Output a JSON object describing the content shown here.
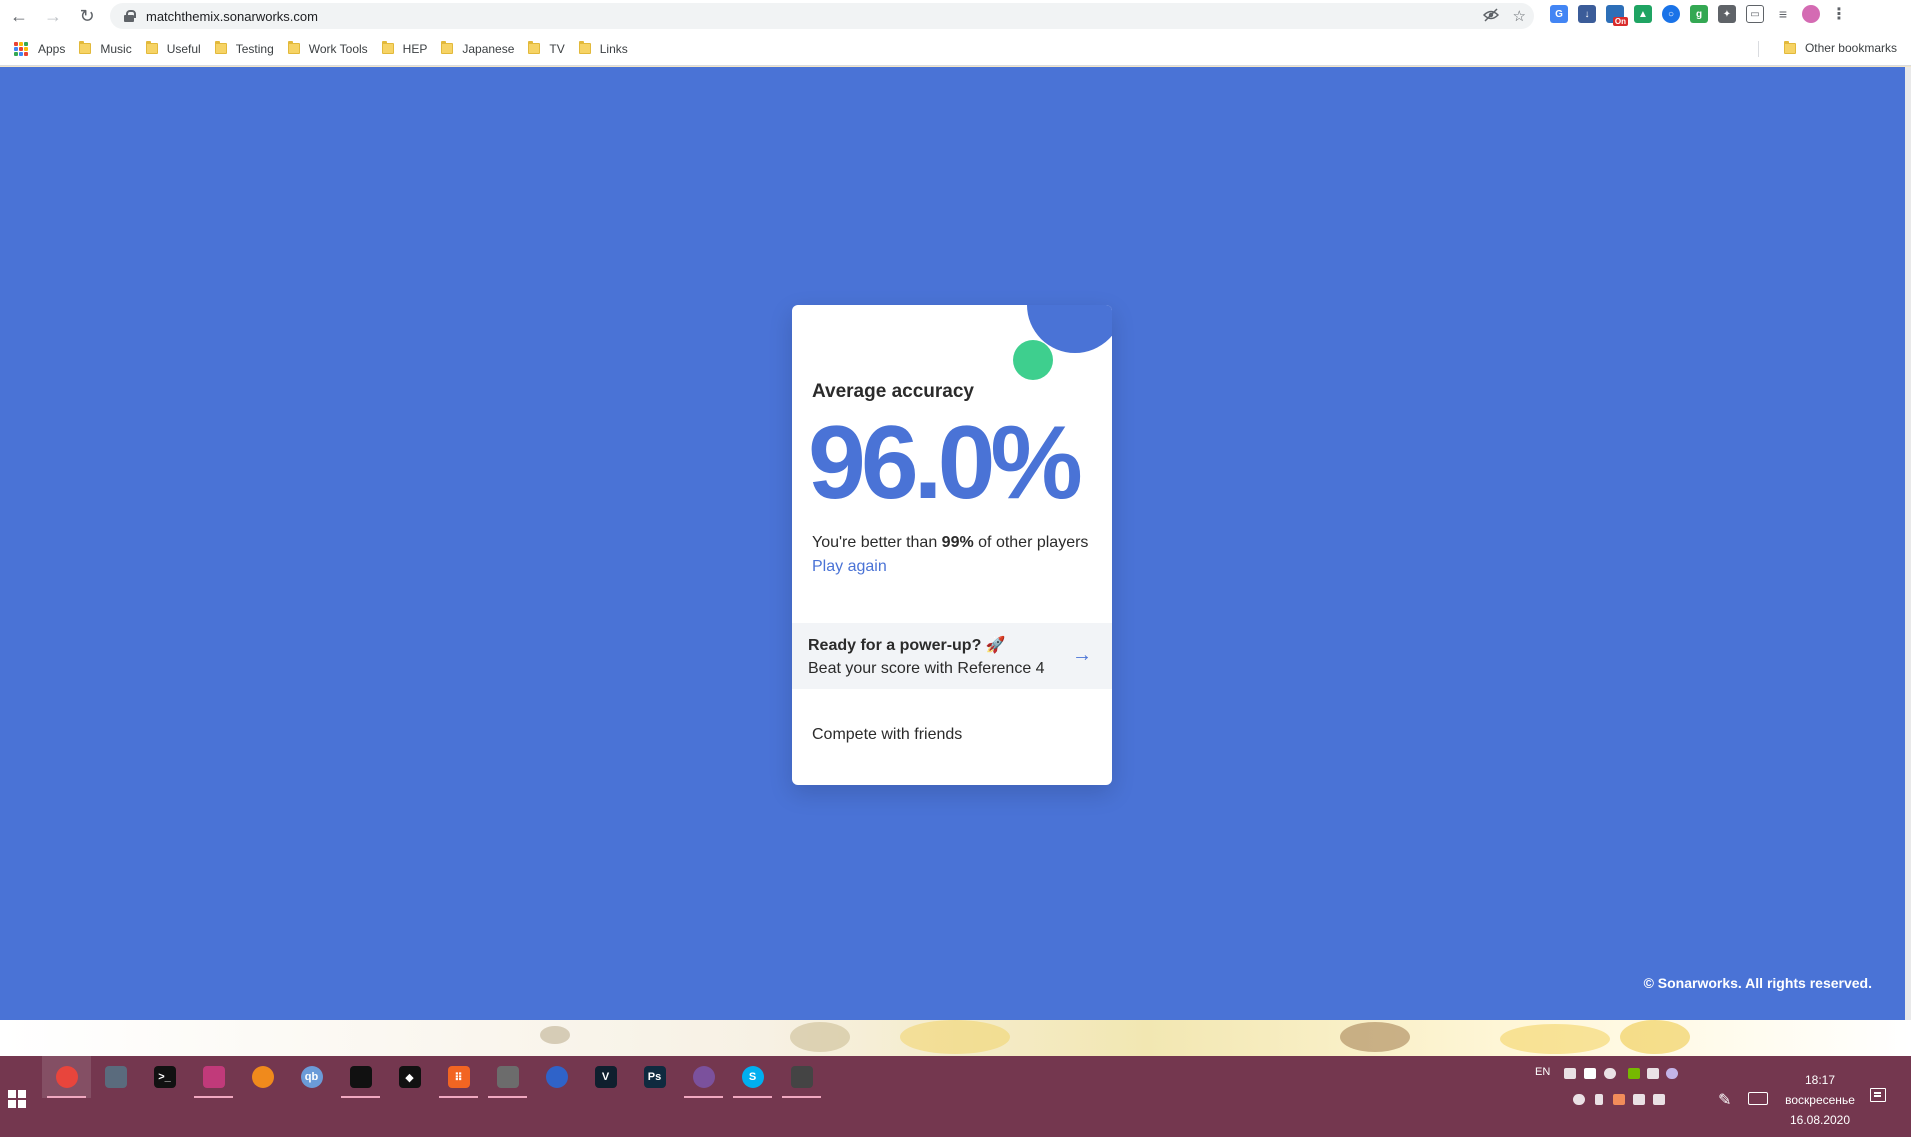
{
  "browser": {
    "url": "matchthemix.sonarworks.com",
    "nav_back": "←",
    "nav_forward": "→",
    "nav_reload": "↻",
    "menu_dots": "⋮",
    "ext_badge": "On"
  },
  "bookmarks": {
    "items": [
      {
        "label": "Apps",
        "icon": "apps-grid-icon"
      },
      {
        "label": "Music",
        "icon": "folder-icon"
      },
      {
        "label": "Useful",
        "icon": "folder-icon"
      },
      {
        "label": "Testing",
        "icon": "folder-icon"
      },
      {
        "label": "Work Tools",
        "icon": "folder-icon"
      },
      {
        "label": "HEP",
        "icon": "folder-icon"
      },
      {
        "label": "Japanese",
        "icon": "folder-icon"
      },
      {
        "label": "TV",
        "icon": "folder-icon"
      },
      {
        "label": "Links",
        "icon": "folder-icon"
      }
    ],
    "other_label": "Other bookmarks"
  },
  "card": {
    "accuracy_label": "Average accuracy",
    "accuracy_value": "96.0%",
    "better_prefix": "You're better than ",
    "better_percent": "99%",
    "better_suffix": " of other players",
    "play_again": "Play again",
    "powerup_title": "Ready for a power-up? 🚀",
    "powerup_subtitle": "Beat your score with Reference 4",
    "arrow": "→",
    "compete": "Compete with friends"
  },
  "footer": {
    "copyright": "© Sonarworks. All rights reserved."
  },
  "taskbar": {
    "apps": [
      {
        "name": "chrome",
        "color": "#e8453c",
        "glyph": ""
      },
      {
        "name": "calculator",
        "color": "#5a6b7d",
        "glyph": ""
      },
      {
        "name": "terminal",
        "color": "#111111",
        "glyph": ">_"
      },
      {
        "name": "save",
        "color": "#c13a7a",
        "glyph": ""
      },
      {
        "name": "audacity",
        "color": "#f08a1c",
        "glyph": ""
      },
      {
        "name": "qbittorrent",
        "color": "#6b9bd8",
        "glyph": "qb"
      },
      {
        "name": "foobar",
        "color": "#111111",
        "glyph": ""
      },
      {
        "name": "tidal",
        "color": "#111111",
        "glyph": "◆"
      },
      {
        "name": "fl-studio",
        "color": "#f26522",
        "glyph": "⠿"
      },
      {
        "name": "virtual-drive",
        "color": "#6c6c6c",
        "glyph": ""
      },
      {
        "name": "portal",
        "color": "#2f63c9",
        "glyph": ""
      },
      {
        "name": "vegas",
        "color": "#0f1f2e",
        "glyph": "V"
      },
      {
        "name": "photoshop",
        "color": "#0f2a3f",
        "glyph": "Ps"
      },
      {
        "name": "viber",
        "color": "#7b519d",
        "glyph": ""
      },
      {
        "name": "skype",
        "color": "#00aff0",
        "glyph": "S"
      },
      {
        "name": "photos",
        "color": "#444444",
        "glyph": ""
      }
    ],
    "lang": "EN",
    "time": "18:17",
    "weekday": "воскресенье",
    "date": "16.08.2020"
  },
  "colors": {
    "page_bg": "#4a73d6",
    "accent": "#4a73d6",
    "green_dot": "#3ecf8e",
    "taskbar": "#74374f"
  }
}
